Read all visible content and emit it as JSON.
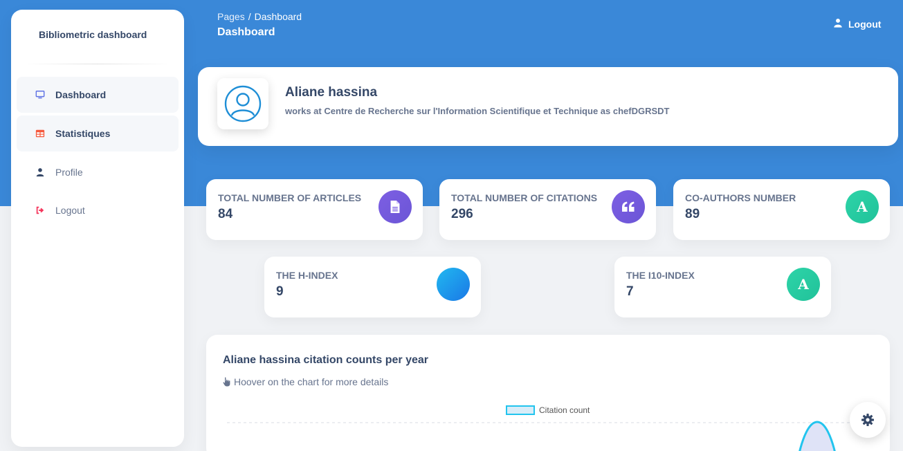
{
  "sidebar": {
    "brand": "Bibliometric dashboard",
    "items": [
      {
        "label": "Dashboard",
        "icon": "monitor-icon"
      },
      {
        "label": "Statistiques",
        "icon": "table-icon"
      },
      {
        "label": "Profile",
        "icon": "user-icon"
      },
      {
        "label": "Logout",
        "icon": "sign-out-icon"
      }
    ]
  },
  "header": {
    "breadcrumb_root": "Pages",
    "breadcrumb_sep": "/",
    "breadcrumb_current": "Dashboard",
    "title": "Dashboard",
    "logout_label": "Logout"
  },
  "profile": {
    "name": "Aliane hassina",
    "subtitle": "works at Centre de Recherche sur l'Information Scientifique et Technique as chefDGRSDT"
  },
  "stats": [
    {
      "label": "TOTAL NUMBER OF ARTICLES",
      "value": "84",
      "icon": "document-icon",
      "color": "#7b5ee2"
    },
    {
      "label": "TOTAL NUMBER OF CITATIONS",
      "value": "296",
      "icon": "quote-icon",
      "color": "#7b5ee2"
    },
    {
      "label": "CO-AUTHORS NUMBER",
      "value": "89",
      "icon": "letter-a-icon",
      "icon_text": "A",
      "color": "#2cd0a6"
    },
    {
      "label": "THE H-INDEX",
      "value": "9",
      "icon": "circle-icon",
      "color": "#1a8ee8"
    },
    {
      "label": "THE I10-INDEX",
      "value": "7",
      "icon": "letter-a-icon",
      "icon_text": "A",
      "color": "#2cd0a6"
    }
  ],
  "chart": {
    "title": "Aliane hassina citation counts per year",
    "hint": "Hoover on the chart for more details",
    "legend_label": "Citation count"
  },
  "colors": {
    "header_bg": "#3a88d8",
    "accent": "#344767"
  }
}
